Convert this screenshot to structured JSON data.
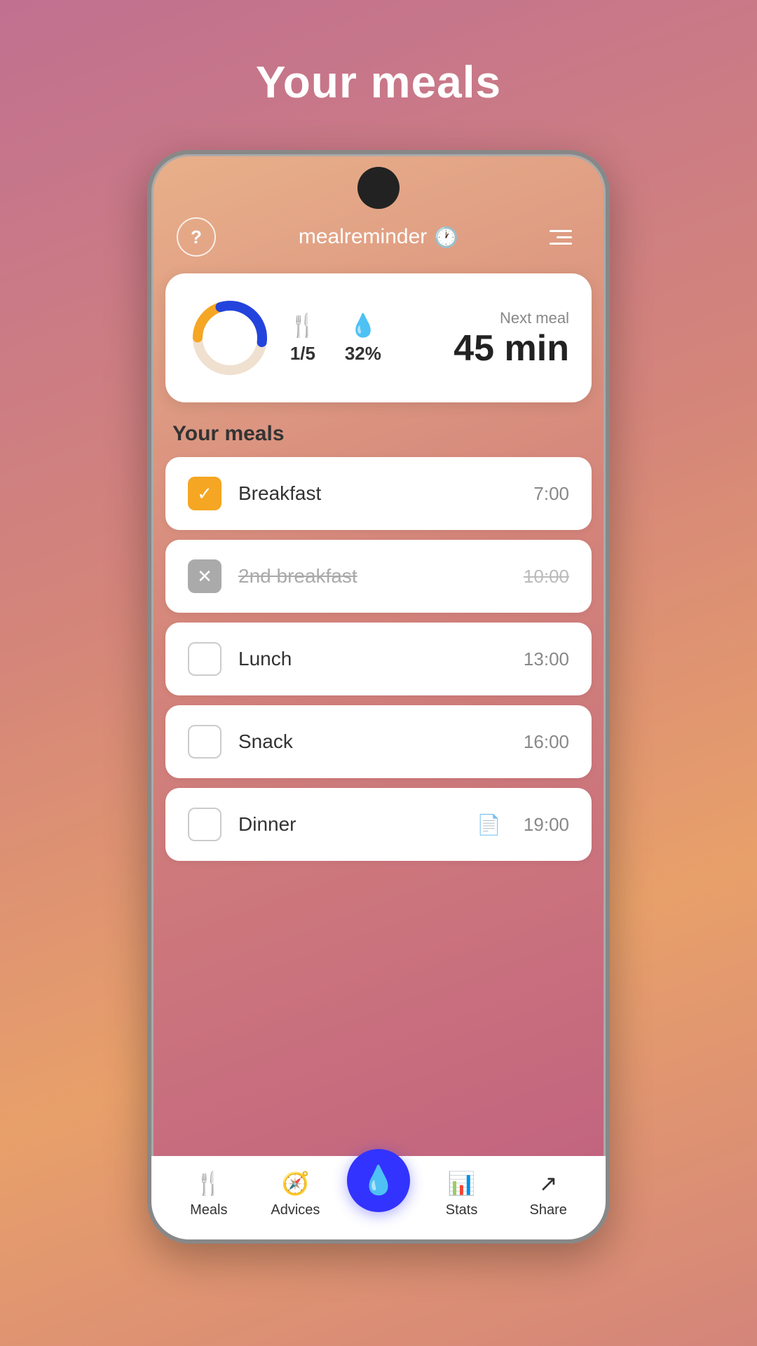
{
  "page": {
    "title": "Your meals",
    "background": "#c17090"
  },
  "header": {
    "help_label": "?",
    "app_name": "mealreminder",
    "settings_label": "settings"
  },
  "summary": {
    "meals_done": "1/5",
    "water_percent": "32%",
    "next_meal_label": "Next meal",
    "next_meal_time": "45 min",
    "donut_orange_percent": 20,
    "donut_blue_percent": 32
  },
  "meals_section_title": "Your meals",
  "meals": [
    {
      "name": "Breakfast",
      "time": "7:00",
      "state": "checked_orange",
      "strikethrough": false,
      "has_note": false
    },
    {
      "name": "2nd breakfast",
      "time": "10:00",
      "state": "checked_gray",
      "strikethrough": true,
      "has_note": false
    },
    {
      "name": "Lunch",
      "time": "13:00",
      "state": "unchecked",
      "strikethrough": false,
      "has_note": false
    },
    {
      "name": "Snack",
      "time": "16:00",
      "state": "unchecked",
      "strikethrough": false,
      "has_note": false
    },
    {
      "name": "Dinner",
      "time": "19:00",
      "state": "unchecked",
      "strikethrough": false,
      "has_note": true
    }
  ],
  "bottom_nav": {
    "meals_label": "Meals",
    "advices_label": "Advices",
    "center_label": "water",
    "stats_label": "Stats",
    "share_label": "Share"
  }
}
